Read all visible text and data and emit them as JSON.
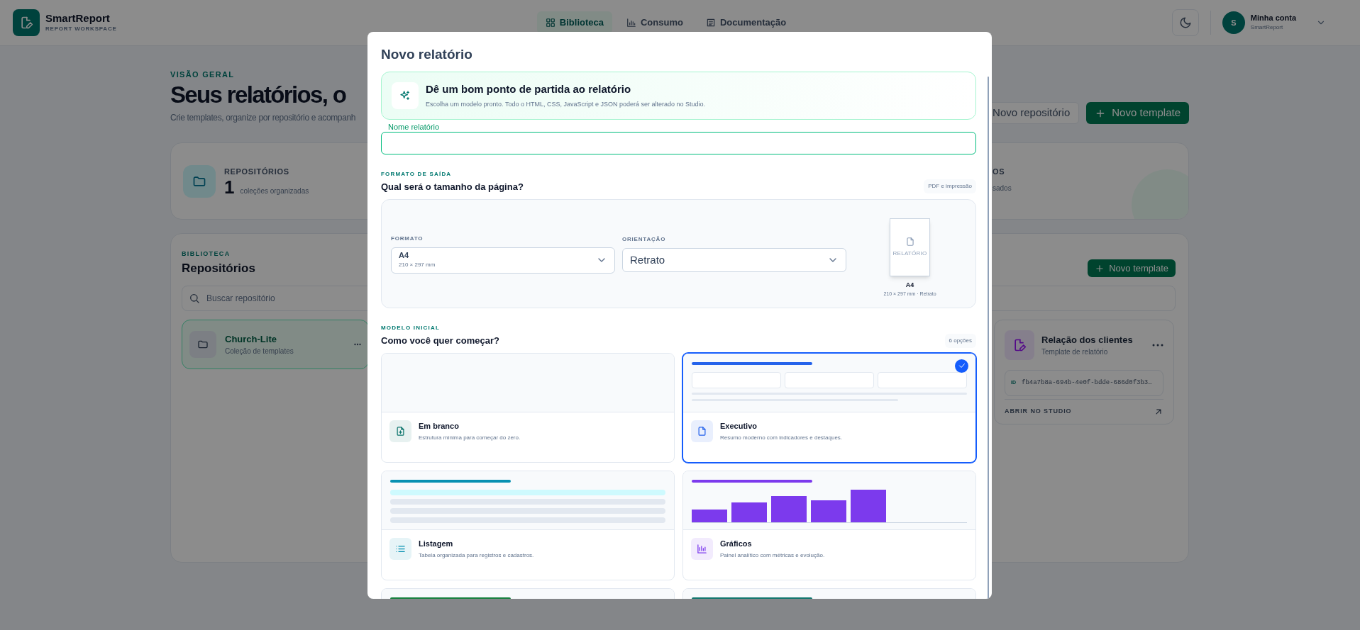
{
  "header": {
    "brand": {
      "name": "SmartReport",
      "tagline": "REPORT WORKSPACE"
    },
    "nav": [
      {
        "label": "Biblioteca",
        "kind": "grid",
        "selected": true
      },
      {
        "label": "Consumo",
        "kind": "chart",
        "selected": false
      },
      {
        "label": "Documentação",
        "kind": "doc",
        "selected": false
      }
    ],
    "account": {
      "initial": "S",
      "name": "Minha conta",
      "org": "SmartReport"
    }
  },
  "page": {
    "eyebrow": "VISÃO GERAL",
    "title": "Seus relatórios, o",
    "subtitle": "Crie templates, organize por repositório e acompanh",
    "actions": [
      {
        "label": "Novo repositório",
        "kind": "secondary"
      },
      {
        "label": "Novo template",
        "kind": "primary"
      }
    ],
    "stats": [
      {
        "label": "REPOSITÓRIOS",
        "value": "1",
        "caption": "coleções organizadas"
      },
      {
        "label": "OS",
        "caption": "sados"
      }
    ],
    "library": {
      "eyebrow": "BIBLIOTECA",
      "title": "Repositórios",
      "new_button": "Novo template",
      "search_placeholder": "Buscar repositório",
      "repositories": [
        {
          "name": "Church-Lite",
          "description": "Coleção de templates",
          "selected": true
        }
      ],
      "templates": [
        {
          "name": "Relação dos clientes",
          "subtitle": "Template de relatório",
          "id_label": "ID",
          "id": "fb4a7b8a-694b-4e0f-bdde-686d0f3b3…",
          "open_label": "ABRIR NO STUDIO"
        }
      ]
    }
  },
  "modal": {
    "title": "Novo relatório",
    "hint": {
      "title": "Dê um bom ponto de partida ao relatório",
      "text": "Escolha um modelo pronto. Todo o HTML, CSS, JavaScript e JSON poderá ser alterado no Studio."
    },
    "name_field": {
      "label": "Nome relatório"
    },
    "output": {
      "eyebrow": "FORMATO DE SAÍDA",
      "title": "Qual será o tamanho da página?",
      "badge": "PDF e impressão",
      "format": {
        "label": "FORMATO",
        "value": "A4",
        "detail": "210 × 297 mm"
      },
      "orientation": {
        "label": "ORIENTAÇÃO",
        "value": "Retrato"
      },
      "preview": {
        "page_label": "RELATÓRIO",
        "size": "A4",
        "detail": "210 × 297 mm · Retrato"
      }
    },
    "starter": {
      "eyebrow": "MODELO INICIAL",
      "title": "Como você quer começar?",
      "badge": "6 opções",
      "templates": [
        {
          "kind": "blank",
          "name": "Em branco",
          "description": "Estrutura mínima para começar do zero.",
          "color": "#0f766e",
          "selected": false
        },
        {
          "kind": "executive",
          "name": "Executivo",
          "description": "Resumo moderno com indicadores e destaques.",
          "color": "#2563eb",
          "selected": true
        },
        {
          "kind": "list",
          "name": "Listagem",
          "description": "Tabela organizada para registros e cadastros.",
          "color": "#0891b2",
          "selected": false
        },
        {
          "kind": "chart",
          "name": "Gráficos",
          "description": "Painel analítico com métricas e evolução.",
          "color": "#7c3aed",
          "selected": false
        },
        {
          "kind": "partial",
          "color": "#15803d",
          "selected": false
        },
        {
          "kind": "partial",
          "color": "#0f766e",
          "selected": false
        }
      ]
    }
  }
}
